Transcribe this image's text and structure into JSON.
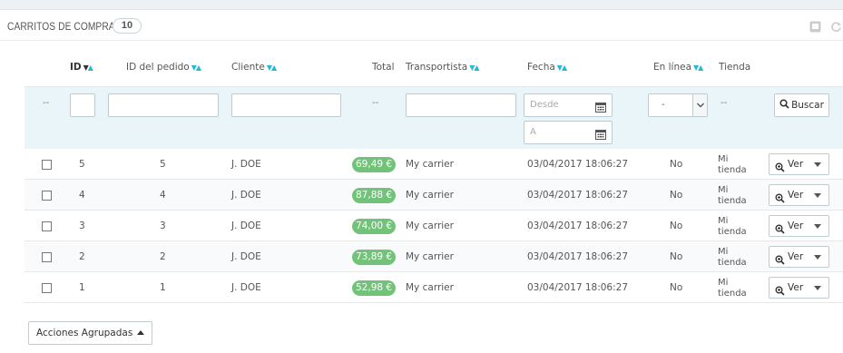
{
  "panel": {
    "title": "CARRITOS DE COMPRA",
    "count": "10"
  },
  "toolbar_icons": [
    "export-icon",
    "refresh-icon"
  ],
  "columns": {
    "id": "ID",
    "order_id": "ID del pedido",
    "customer": "Cliente",
    "total": "Total",
    "carrier": "Transportista",
    "date": "Fecha",
    "online": "En línea",
    "shop": "Tienda"
  },
  "filters": {
    "dash": "--",
    "date_from_placeholder": "Desde",
    "date_to_placeholder": "A",
    "online_selected": "-",
    "search_button": "Buscar"
  },
  "rows": [
    {
      "id": "5",
      "order_id": "5",
      "customer": "J. DOE",
      "total": "69,49 €",
      "carrier": "My carrier",
      "date": "03/04/2017 18:06:27",
      "online": "No",
      "shop_line1": "Mi",
      "shop_line2": "tienda",
      "action": "Ver"
    },
    {
      "id": "4",
      "order_id": "4",
      "customer": "J. DOE",
      "total": "87,88 €",
      "carrier": "My carrier",
      "date": "03/04/2017 18:06:27",
      "online": "No",
      "shop_line1": "Mi",
      "shop_line2": "tienda",
      "action": "Ver"
    },
    {
      "id": "3",
      "order_id": "3",
      "customer": "J. DOE",
      "total": "74,00 €",
      "carrier": "My carrier",
      "date": "03/04/2017 18:06:27",
      "online": "No",
      "shop_line1": "Mi",
      "shop_line2": "tienda",
      "action": "Ver"
    },
    {
      "id": "2",
      "order_id": "2",
      "customer": "J. DOE",
      "total": "73,89 €",
      "carrier": "My carrier",
      "date": "03/04/2017 18:06:27",
      "online": "No",
      "shop_line1": "Mi",
      "shop_line2": "tienda",
      "action": "Ver"
    },
    {
      "id": "1",
      "order_id": "1",
      "customer": "J. DOE",
      "total": "52,98 €",
      "carrier": "My carrier",
      "date": "03/04/2017 18:06:27",
      "online": "No",
      "shop_line1": "Mi",
      "shop_line2": "tienda",
      "action": "Ver"
    }
  ],
  "bulk_actions_label": "Acciones Agrupadas",
  "colors": {
    "accent": "#25b9d7",
    "price_badge": "#72c279",
    "filter_bg": "#eaf5fa"
  }
}
